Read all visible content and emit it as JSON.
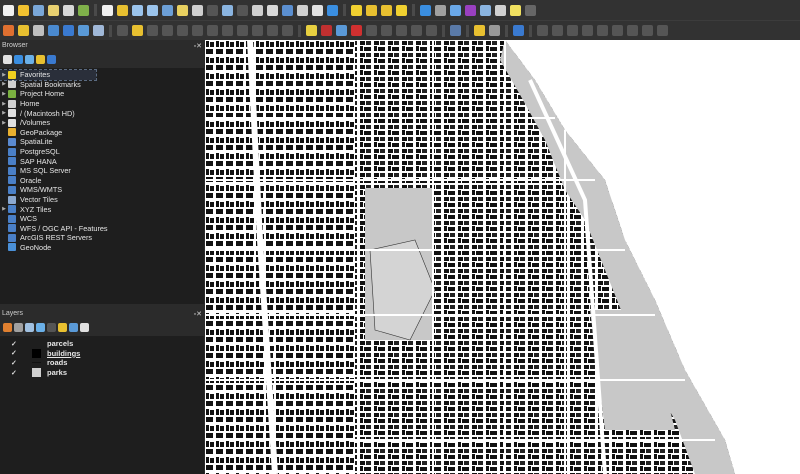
{
  "toolbar_row1": [
    {
      "name": "new-project-icon",
      "color": "#f0f0f0"
    },
    {
      "name": "open-project-icon",
      "color": "#f2c230"
    },
    {
      "name": "save-project-icon",
      "color": "#7aa7d8"
    },
    {
      "name": "new-print-layout-icon",
      "color": "#e8d070"
    },
    {
      "name": "layout-manager-icon",
      "color": "#d8d8d8"
    },
    {
      "name": "style-manager-icon",
      "color": "#7fb04a"
    },
    {
      "sep": true
    },
    {
      "name": "pan-icon",
      "color": "#f0f0f0"
    },
    {
      "name": "pan-to-selection-icon",
      "color": "#e8c030"
    },
    {
      "name": "zoom-in-icon",
      "color": "#9bc4ec"
    },
    {
      "name": "zoom-out-icon",
      "color": "#9bc4ec"
    },
    {
      "name": "zoom-full-icon",
      "color": "#6c9fd6"
    },
    {
      "name": "zoom-to-selection-icon",
      "color": "#e8d060"
    },
    {
      "name": "zoom-to-layer-icon",
      "color": "#cfcfcf"
    },
    {
      "name": "zoom-native-icon",
      "color": "#555"
    },
    {
      "name": "zoom-last-icon",
      "color": "#8ab4e0"
    },
    {
      "name": "zoom-next-icon",
      "color": "#555"
    },
    {
      "name": "new-map-view-icon",
      "color": "#cfcfcf"
    },
    {
      "name": "new-3d-map-view-icon",
      "color": "#d8d8d8"
    },
    {
      "name": "new-bookmark-icon",
      "color": "#5b8fd0"
    },
    {
      "name": "show-bookmarks-icon",
      "color": "#cfcfcf"
    },
    {
      "name": "temporal-controller-icon",
      "color": "#e0e0e0"
    },
    {
      "name": "refresh-icon",
      "color": "#3a8ee0"
    },
    {
      "sep": true
    },
    {
      "name": "select-features-icon",
      "color": "#f0d030"
    },
    {
      "name": "select-by-value-icon",
      "color": "#e8c030"
    },
    {
      "name": "deselect-icon",
      "color": "#e8c030"
    },
    {
      "name": "select-location-icon",
      "color": "#f0d030"
    },
    {
      "sep": true
    },
    {
      "name": "identify-icon",
      "color": "#3a8ee0"
    },
    {
      "name": "attribute-table-icon",
      "color": "#a0a0a0"
    },
    {
      "name": "toolbox-icon",
      "color": "#6aa8e8"
    },
    {
      "name": "statistics-icon",
      "color": "#9a40c0"
    },
    {
      "name": "field-calculator-icon",
      "color": "#8ab4e0"
    },
    {
      "name": "measure-icon",
      "color": "#d0d0d0"
    },
    {
      "name": "map-tips-icon",
      "color": "#f0e060"
    },
    {
      "name": "locator-icon",
      "color": "#666"
    }
  ],
  "toolbar_row2": [
    {
      "name": "data-source-manager-icon",
      "color": "#e07030"
    },
    {
      "name": "new-geopackage-layer-icon",
      "color": "#e8c030"
    },
    {
      "name": "digitize-points-icon",
      "color": "#c0c0c0"
    },
    {
      "name": "new-line-layer-icon",
      "color": "#4a8ad0"
    },
    {
      "name": "new-polygon-layer-icon",
      "color": "#3a7ad0"
    },
    {
      "name": "new-virtual-layer-icon",
      "color": "#5a9ad8"
    },
    {
      "name": "new-temporary-layer-icon",
      "color": "#a0b8d8"
    },
    {
      "sep": true
    },
    {
      "name": "current-edits-icon",
      "color": "#555"
    },
    {
      "name": "toggle-editing-icon",
      "color": "#e8c030"
    },
    {
      "name": "save-edits-icon",
      "color": "#555"
    },
    {
      "name": "add-feature-icon",
      "color": "#555"
    },
    {
      "name": "vertex-tool-icon",
      "color": "#555"
    },
    {
      "name": "modify-attributes-icon",
      "color": "#555"
    },
    {
      "name": "delete-selected-icon",
      "color": "#555"
    },
    {
      "name": "cut-features-icon",
      "color": "#555"
    },
    {
      "name": "copy-features-icon",
      "color": "#555"
    },
    {
      "name": "paste-features-icon",
      "color": "#555"
    },
    {
      "name": "undo-icon",
      "color": "#555"
    },
    {
      "name": "redo-icon",
      "color": "#555"
    },
    {
      "sep": true
    },
    {
      "name": "label-toolbar-icon",
      "color": "#e8d040"
    },
    {
      "name": "layer-labeling-icon",
      "color": "#c03030"
    },
    {
      "name": "pin-labels-icon",
      "color": "#5a9ad8"
    },
    {
      "name": "show-hide-labels-icon",
      "color": "#d03030"
    },
    {
      "name": "move-label-icon",
      "color": "#555"
    },
    {
      "name": "rotate-label-icon",
      "color": "#555"
    },
    {
      "name": "change-label-icon",
      "color": "#555"
    },
    {
      "name": "label-properties-icon",
      "color": "#555"
    },
    {
      "name": "diagram-icon",
      "color": "#555"
    },
    {
      "sep": true
    },
    {
      "name": "quickmapservices-icon",
      "color": "#5a7aa8"
    },
    {
      "sep": true
    },
    {
      "name": "python-console-icon",
      "color": "#e8c030"
    },
    {
      "name": "svg-export-icon",
      "color": "#999"
    },
    {
      "sep": true
    },
    {
      "name": "help-icon",
      "color": "#3a7ad0"
    },
    {
      "sep": true
    },
    {
      "name": "profile-tool-icon",
      "color": "#555"
    },
    {
      "name": "profile-add-icon",
      "color": "#555"
    },
    {
      "name": "profile-tool-2-icon",
      "color": "#555"
    },
    {
      "name": "profile-add-2-icon",
      "color": "#555"
    },
    {
      "name": "shade-tool-icon",
      "color": "#555"
    },
    {
      "name": "shade-tool-2-icon",
      "color": "#555"
    },
    {
      "name": "shade-tool-3-icon",
      "color": "#555"
    },
    {
      "name": "shade-tool-4-icon",
      "color": "#555"
    },
    {
      "name": "shade-tool-5-icon",
      "color": "#555"
    }
  ],
  "browser": {
    "title": "Browser",
    "buttons": [
      {
        "name": "add-layer-icon",
        "color": "#e0e0e0"
      },
      {
        "name": "refresh-icon",
        "color": "#3a8ee0"
      },
      {
        "name": "filter-icon",
        "color": "#6ab0e8"
      },
      {
        "name": "collapse-all-icon",
        "color": "#e8c030"
      },
      {
        "name": "properties-icon",
        "color": "#3a7ad0"
      }
    ],
    "items": [
      {
        "label": "Favorites",
        "icon": "star-icon",
        "color": "#f0d020",
        "expand": true
      },
      {
        "label": "Spatial Bookmarks",
        "icon": "bookmark-icon",
        "color": "#d0d0d0",
        "expand": true
      },
      {
        "label": "Project Home",
        "icon": "project-home-icon",
        "color": "#7ab040",
        "expand": true
      },
      {
        "label": "Home",
        "icon": "home-folder-icon",
        "color": "#d0d0d0",
        "expand": true
      },
      {
        "label": "/ (Macintosh HD)",
        "icon": "folder-icon",
        "color": "#e0e0e0",
        "expand": true
      },
      {
        "label": "/Volumes",
        "icon": "folder-icon",
        "color": "#e0e0e0",
        "expand": true
      },
      {
        "label": "GeoPackage",
        "icon": "geopackage-icon",
        "color": "#e8b030",
        "expand": false
      },
      {
        "label": "SpatiaLite",
        "icon": "spatialite-icon",
        "color": "#5a8ad0",
        "expand": false
      },
      {
        "label": "PostgreSQL",
        "icon": "postgresql-icon",
        "color": "#4a80c8",
        "expand": false
      },
      {
        "label": "SAP HANA",
        "icon": "sap-hana-icon",
        "color": "#4a80c8",
        "expand": false
      },
      {
        "label": "MS SQL Server",
        "icon": "mssql-icon",
        "color": "#4a80c8",
        "expand": false
      },
      {
        "label": "Oracle",
        "icon": "oracle-icon",
        "color": "#4a80c8",
        "expand": false
      },
      {
        "label": "WMS/WMTS",
        "icon": "wms-icon",
        "color": "#4a80c8",
        "expand": false
      },
      {
        "label": "Vector Tiles",
        "icon": "vector-tiles-icon",
        "color": "#8aa8d0",
        "expand": false
      },
      {
        "label": "XYZ Tiles",
        "icon": "xyz-tiles-icon",
        "color": "#4a80c8",
        "expand": true
      },
      {
        "label": "WCS",
        "icon": "wcs-icon",
        "color": "#4a80c8",
        "expand": false
      },
      {
        "label": "WFS / OGC API - Features",
        "icon": "wfs-icon",
        "color": "#4a80c8",
        "expand": false
      },
      {
        "label": "ArcGIS REST Servers",
        "icon": "arcgis-icon",
        "color": "#4a80c8",
        "expand": false
      },
      {
        "label": "GeoNode",
        "icon": "geonode-icon",
        "color": "#4a90d8",
        "expand": false
      }
    ]
  },
  "layers": {
    "title": "Layers",
    "buttons": [
      {
        "name": "open-styling-icon",
        "color": "#e08030"
      },
      {
        "name": "add-group-icon",
        "color": "#a0a0a0"
      },
      {
        "name": "manage-visibility-icon",
        "color": "#a0c0e0"
      },
      {
        "name": "filter-legend-icon",
        "color": "#6ab0e8"
      },
      {
        "name": "filter-expression-icon",
        "color": "#555"
      },
      {
        "name": "expand-all-icon",
        "color": "#e8c030"
      },
      {
        "name": "collapse-all-icon",
        "color": "#5a9ad8"
      },
      {
        "name": "remove-layer-icon",
        "color": "#e0e0e0"
      }
    ],
    "items": [
      {
        "label": "parcels",
        "swatch": "#1e1e1e",
        "checked": true
      },
      {
        "label": "buildings",
        "swatch": "#000000",
        "checked": true,
        "active": true
      },
      {
        "label": "roads",
        "swatch": "line",
        "checked": true
      },
      {
        "label": "parks",
        "swatch": "#d0d0d0",
        "checked": true
      }
    ]
  },
  "map": {
    "land": "#ffffff",
    "buildings": "#111111",
    "parks": "#c8c8c8",
    "water": "#ffffff"
  }
}
